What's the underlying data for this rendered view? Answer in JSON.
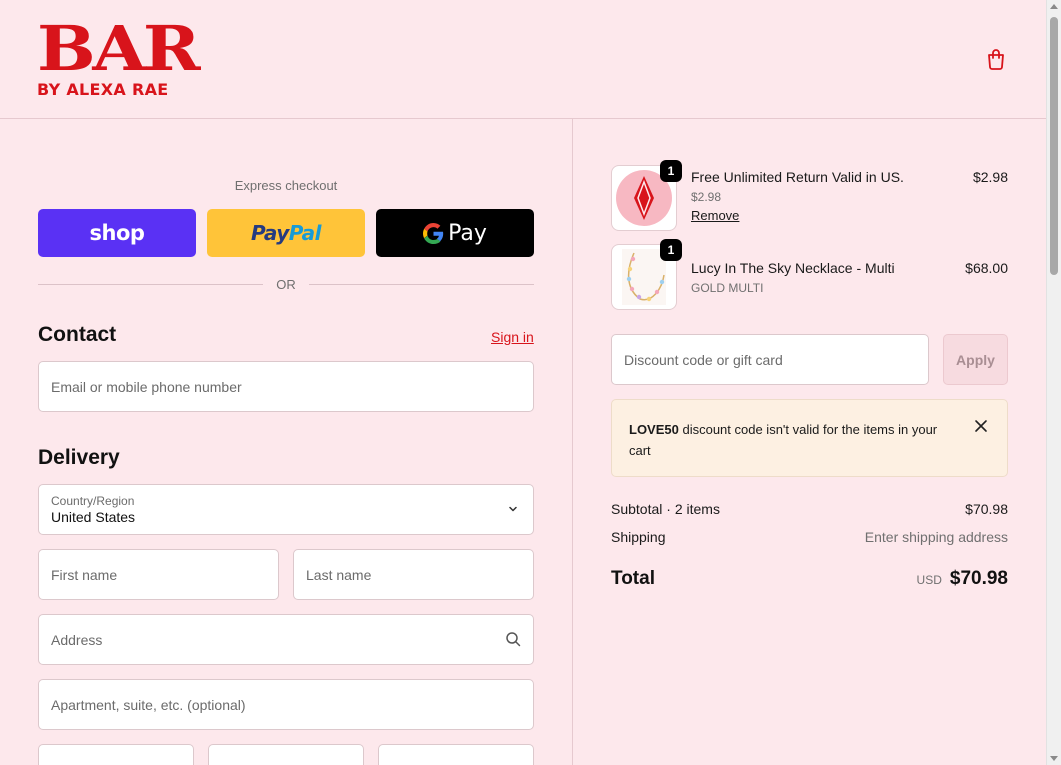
{
  "brand": {
    "logo_main": "BAR",
    "logo_sub": "BY ALEXA RAE",
    "color": "#d8141b"
  },
  "header": {
    "cart_icon": "shopping-bag-icon"
  },
  "express": {
    "label": "Express checkout",
    "shop_label": "shop",
    "paypal_pay": "Pay",
    "paypal_pal": "Pal",
    "gpay_label": "Pay",
    "or_label": "OR"
  },
  "contact": {
    "title": "Contact",
    "sign_in": "Sign in",
    "email_placeholder": "Email or mobile phone number"
  },
  "delivery": {
    "title": "Delivery",
    "country_label": "Country/Region",
    "country_value": "United States",
    "first_name_placeholder": "First name",
    "last_name_placeholder": "Last name",
    "address_placeholder": "Address",
    "apartment_placeholder": "Apartment, suite, etc. (optional)"
  },
  "cart": {
    "items": [
      {
        "name": "Free Unlimited Return Valid in US.",
        "sub": "$2.98",
        "price": "$2.98",
        "qty": "1",
        "remove": "Remove"
      },
      {
        "name": "Lucy In The Sky Necklace - Multi",
        "sub": "GOLD MULTI",
        "price": "$68.00",
        "qty": "1"
      }
    ]
  },
  "discount": {
    "placeholder": "Discount code or gift card",
    "apply": "Apply",
    "notice_code": "LOVE50",
    "notice_text": " discount code isn't valid for the items in your cart"
  },
  "summary": {
    "subtotal_label": "Subtotal · 2 items",
    "subtotal_value": "$70.98",
    "shipping_label": "Shipping",
    "shipping_value": "Enter shipping address",
    "total_label": "Total",
    "total_currency": "USD",
    "total_value": "$70.98"
  }
}
